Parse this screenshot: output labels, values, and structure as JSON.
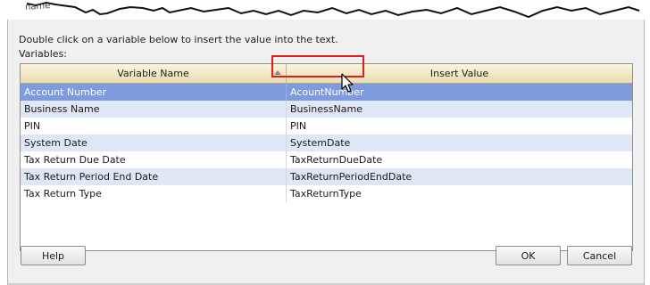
{
  "window": {
    "title_fragment": "name"
  },
  "dialog": {
    "instruction": "Double click on a variable below to insert the value into the text.",
    "variables_label": "Variables:"
  },
  "grid": {
    "columns": [
      "Variable Name",
      "Insert Value"
    ],
    "sort_icon": "sort-ascending-icon",
    "selected_row": 0,
    "rows": [
      {
        "name": "Account Number",
        "value": "AcountNumber"
      },
      {
        "name": "Business Name",
        "value": "BusinessName"
      },
      {
        "name": "PIN",
        "value": "PIN"
      },
      {
        "name": "System Date",
        "value": "SystemDate"
      },
      {
        "name": "Tax Return Due Date",
        "value": "TaxReturnDueDate"
      },
      {
        "name": "Tax Return Period End Date",
        "value": "TaxReturnPeriodEndDate"
      },
      {
        "name": "Tax Return Type",
        "value": "TaxReturnType"
      }
    ]
  },
  "buttons": {
    "help": "Help",
    "ok": "OK",
    "cancel": "Cancel"
  },
  "colors": {
    "selection": "#7f9bdf",
    "alt_row": "#dfe7f6",
    "annotation_box": "#e21b1b"
  },
  "icons": {
    "cursor": "mouse-pointer-icon"
  }
}
